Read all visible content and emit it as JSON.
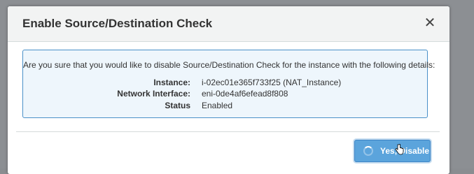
{
  "dialog": {
    "title": "Enable Source/Destination Check",
    "close_glyph": "✕",
    "message": "Are you sure that you would like to disable Source/Destination Check for the instance with the following details:",
    "details": [
      {
        "label": "Instance:",
        "value": "i-02ec01e365f733f25 (NAT_Instance)"
      },
      {
        "label": "Network Interface:",
        "value": "eni-0de4af6efead8f808"
      },
      {
        "label": "Status",
        "value": "Enabled"
      }
    ],
    "confirm_label": "Yes, Disable"
  },
  "icons": {
    "close": "close-icon",
    "spinner": "spinner-icon",
    "cursor": "hand-cursor-icon"
  },
  "colors": {
    "info_border": "#4a90c8",
    "info_background": "#eef6fc",
    "primary_button": "#5ba4dc"
  }
}
